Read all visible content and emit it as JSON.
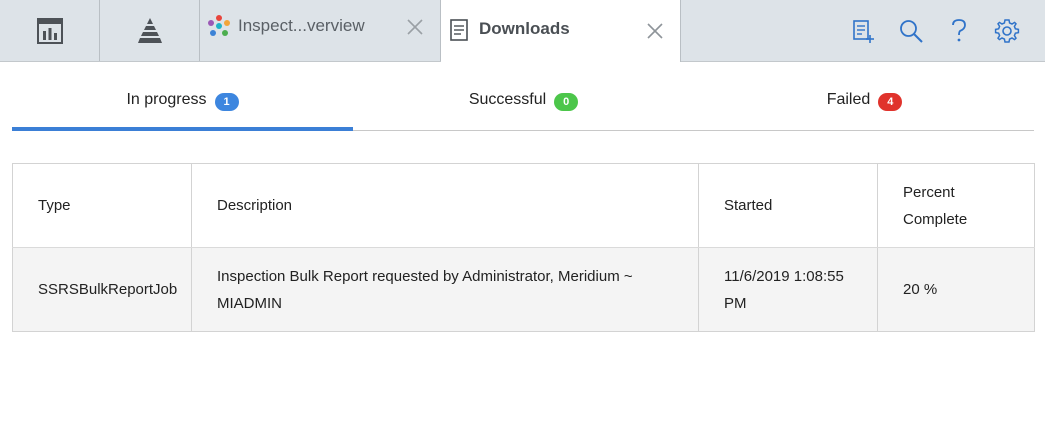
{
  "tabs": {
    "inspection_label": "Inspect...verview",
    "downloads_label": "Downloads"
  },
  "icons": {
    "tile1": "dashboard-chart-icon",
    "tile2": "hierarchy-pyramid-icon",
    "inspection_tab": "colorful-network-icon",
    "downloads_tab": "document-icon",
    "tools": [
      "new-report-icon",
      "search-icon",
      "help-icon",
      "settings-gear-icon"
    ]
  },
  "status_tabs": [
    {
      "label": "In progress",
      "count": "1",
      "color": "#3d86df",
      "active": true
    },
    {
      "label": "Successful",
      "count": "0",
      "color": "#4cc64a",
      "active": false
    },
    {
      "label": "Failed",
      "count": "4",
      "color": "#e0332c",
      "active": false
    }
  ],
  "table": {
    "headers": {
      "type": "Type",
      "description": "Description",
      "started": "Started",
      "percent_line1": "Percent",
      "percent_line2": "Complete"
    },
    "rows": [
      {
        "type": "SSRSBulkReportJob",
        "description_line1": "Inspection Bulk Report requested by Administrator, Meridium ~",
        "description_line2": "MIADMIN",
        "started_line1": "11/6/2019 1:08:55",
        "started_line2": "PM",
        "percent": "20 %"
      }
    ]
  },
  "colors": {
    "accent": "#3b7fd6",
    "topbar": "#dde3e8",
    "row_bg": "#f4f4f4"
  }
}
